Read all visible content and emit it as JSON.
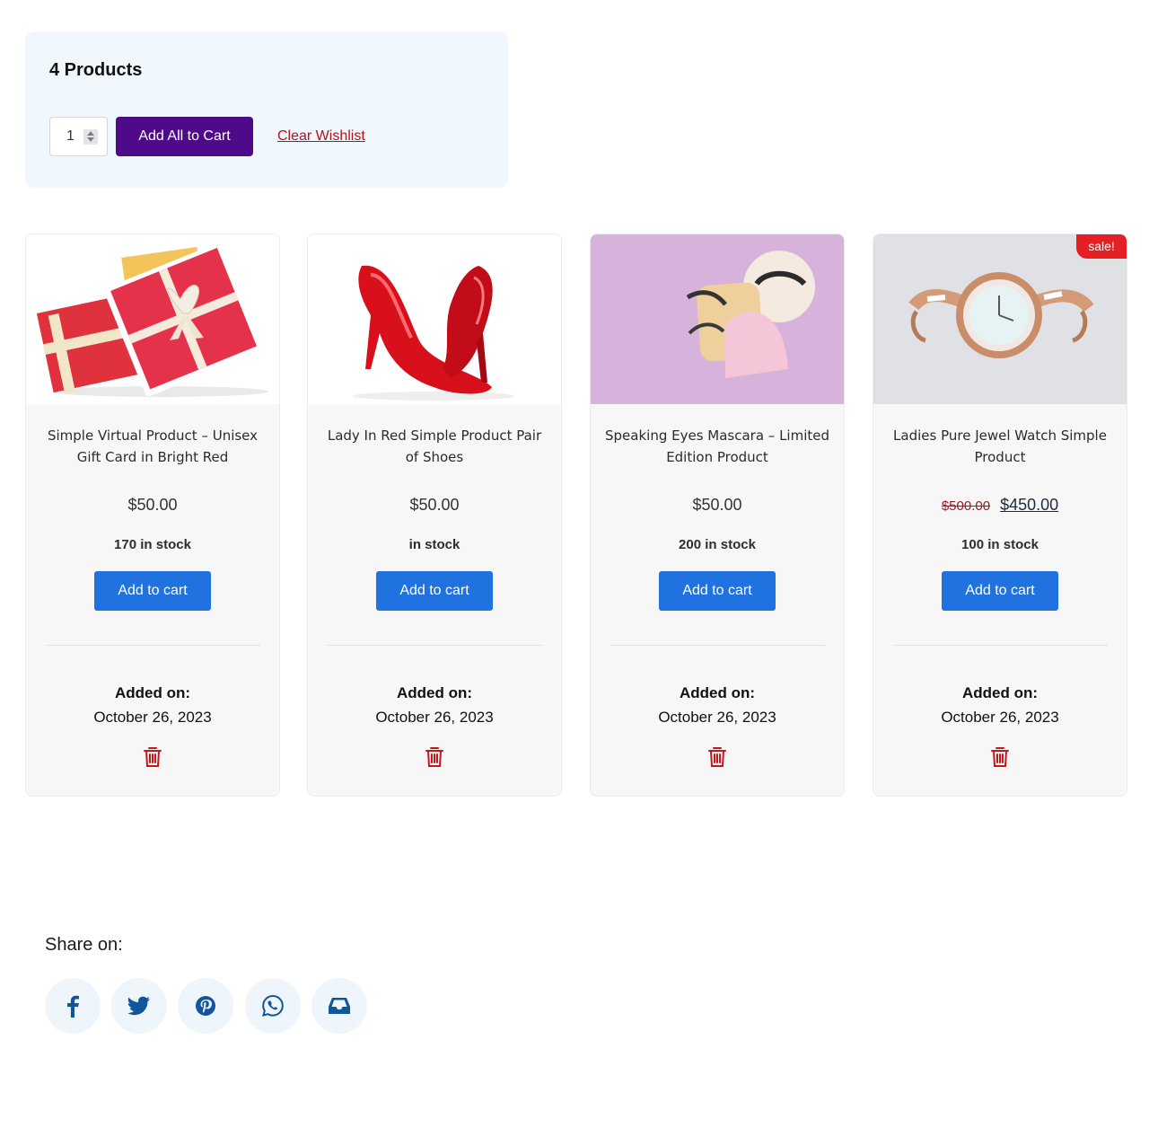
{
  "summary": {
    "count_label": "4 Products",
    "quantity": "1",
    "add_all_label": "Add All to Cart",
    "clear_label": "Clear Wishlist"
  },
  "products": [
    {
      "title": "Simple Virtual Product – Unisex Gift Card in Bright Red",
      "price": "$50.00",
      "stock": "170 in stock",
      "button": "Add to cart",
      "added_label": "Added on:",
      "added_date": "October 26, 2023",
      "image": "gift-box-image"
    },
    {
      "title": "Lady In Red Simple Product Pair of Shoes",
      "price": "$50.00",
      "stock": "in stock",
      "button": "Add to cart",
      "added_label": "Added on:",
      "added_date": "October 26, 2023",
      "image": "red-heels-image"
    },
    {
      "title": "Speaking Eyes Mascara – Limited Edition Product",
      "price": "$50.00",
      "stock": "200 in stock",
      "button": "Add to cart",
      "added_label": "Added on:",
      "added_date": "October 26, 2023",
      "image": "eyelashes-image"
    },
    {
      "title": "Ladies Pure Jewel Watch Simple Product",
      "old_price": "$500.00",
      "price": "$450.00",
      "stock": "100 in stock",
      "button": "Add to cart",
      "added_label": "Added on:",
      "added_date": "October 26, 2023",
      "badge": "sale!",
      "image": "watch-image"
    }
  ],
  "share": {
    "label": "Share on:",
    "networks": [
      "facebook-icon",
      "twitter-icon",
      "pinterest-icon",
      "whatsapp-icon",
      "email-inbox-icon"
    ]
  },
  "colors": {
    "primary_purple": "#4e0a8b",
    "cart_blue": "#1f72df",
    "danger_red": "#b4121a",
    "social_blue": "#11569c"
  }
}
